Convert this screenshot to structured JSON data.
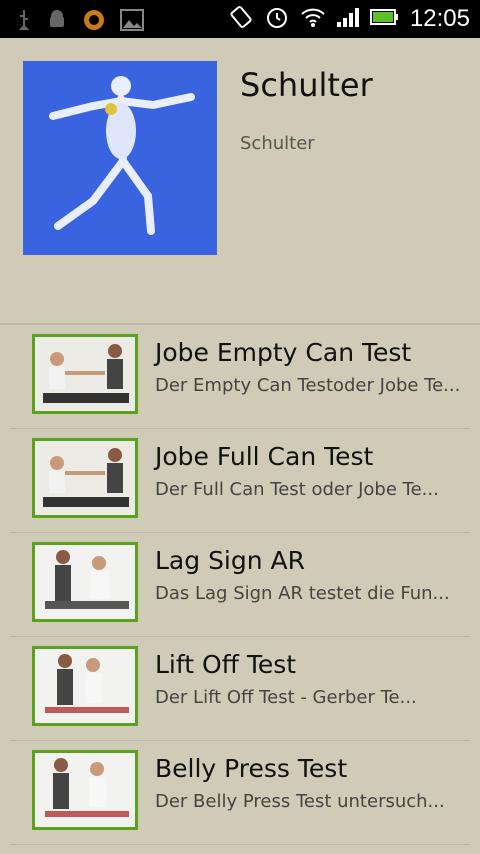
{
  "statusbar": {
    "time": "12:05",
    "left_icons": [
      "usb-icon",
      "android-debug-icon",
      "app-notification-icon",
      "image-icon"
    ],
    "right_icons": [
      "rotate-icon",
      "alarm-icon",
      "wifi-icon",
      "signal-icon",
      "battery-icon"
    ]
  },
  "header": {
    "title": "Schulter",
    "subtitle": "Schulter"
  },
  "items": [
    {
      "title": "Jobe Empty Can Test",
      "desc": "Der Empty Can Testoder Jobe Te..."
    },
    {
      "title": "Jobe Full Can Test",
      "desc": "Der Full Can Test oder Jobe Te..."
    },
    {
      "title": "Lag Sign AR",
      "desc": "Das Lag Sign AR testet die Fun..."
    },
    {
      "title": "Lift Off Test",
      "desc": "Der Lift Off Test  - Gerber Te..."
    },
    {
      "title": "Belly Press Test",
      "desc": "Der Belly Press Test untersuch..."
    }
  ],
  "colors": {
    "background": "#cfcbb6",
    "thumb_border": "#5aa21e",
    "hero_bg": "#3a63e0"
  }
}
